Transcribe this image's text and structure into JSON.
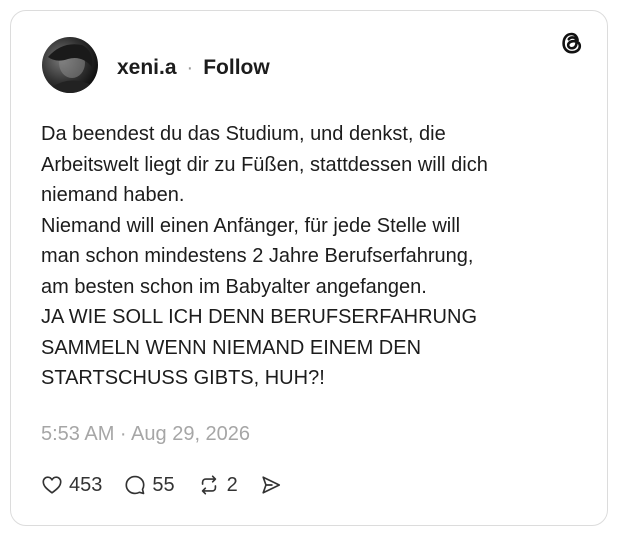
{
  "post": {
    "username": "xeni.a",
    "separator": "·",
    "follow_label": "Follow",
    "text_lines": [
      "Da beendest du das Studium, und denkst, die",
      "Arbeitswelt liegt dir zu Füßen, stattdessen will dich",
      "niemand haben.",
      "Niemand will einen Anfänger, für jede Stelle will",
      "man schon mindestens 2 Jahre Berufserfahrung,",
      "am besten schon im Babyalter angefangen.",
      "JA WIE SOLL ICH DENN BERUFSERFAHRUNG",
      "SAMMELN WENN NIEMAND EINEM DEN",
      "STARTSCHUSS GIBTS, HUH?!"
    ],
    "timestamp": "5:53 AM · Aug 29, 2026"
  },
  "actions": {
    "likes": "453",
    "replies": "55",
    "reposts": "2"
  },
  "icons": {
    "logo": "threads-logo-icon",
    "like": "heart-icon",
    "reply": "comment-icon",
    "repost": "repost-icon",
    "share": "share-icon"
  },
  "colors": {
    "text": "#1c1c1c",
    "muted": "#a6a6a6",
    "border": "#dcdcdc"
  }
}
